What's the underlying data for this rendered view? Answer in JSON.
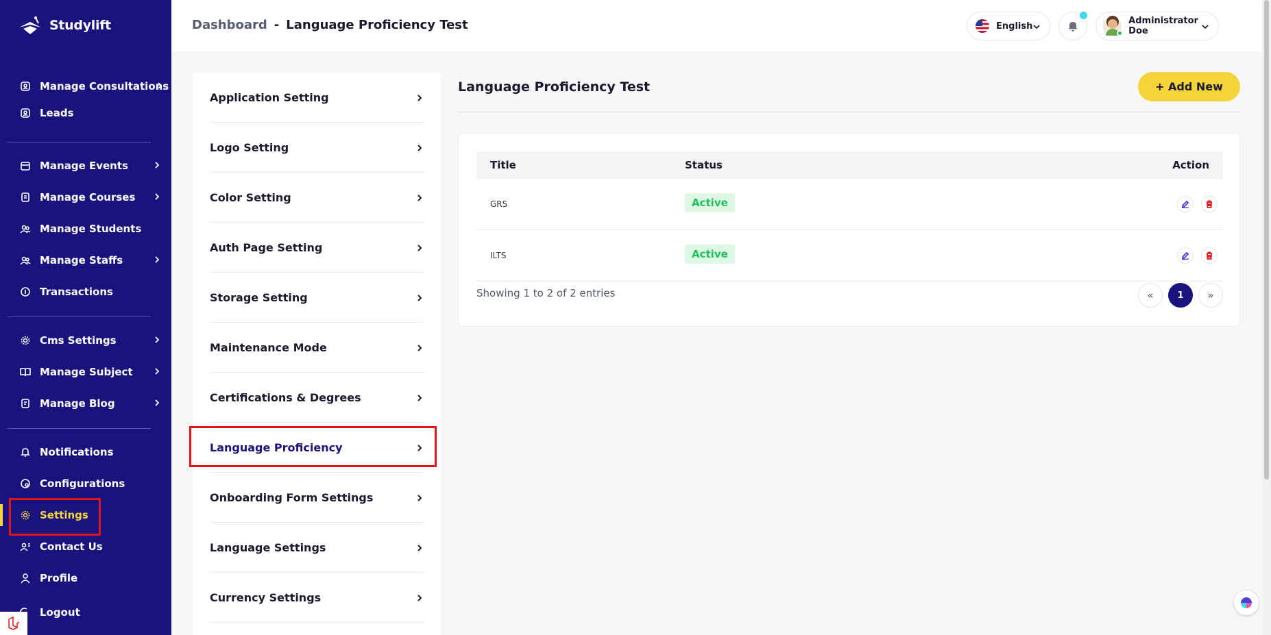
{
  "brand": {
    "name": "Studylift"
  },
  "sidebar": {
    "items": [
      {
        "label": "Manage Consultations",
        "icon": "user-card-icon",
        "chevron": true
      },
      {
        "label": "Leads",
        "icon": "user-card-icon",
        "chevron": false
      },
      {
        "label": "Manage Events",
        "icon": "calendar-icon",
        "chevron": true
      },
      {
        "label": "Manage Courses",
        "icon": "book-icon",
        "chevron": true
      },
      {
        "label": "Manage Students",
        "icon": "users-icon",
        "chevron": false
      },
      {
        "label": "Manage Staffs",
        "icon": "users-icon",
        "chevron": true
      },
      {
        "label": "Transactions",
        "icon": "coin-icon",
        "chevron": false
      },
      {
        "label": "Cms Settings",
        "icon": "gear-icon",
        "chevron": true
      },
      {
        "label": "Manage Subject",
        "icon": "open-book-icon",
        "chevron": true
      },
      {
        "label": "Manage Blog",
        "icon": "document-icon",
        "chevron": true
      },
      {
        "label": "Notifications",
        "icon": "bell-icon",
        "chevron": false
      },
      {
        "label": "Configurations",
        "icon": "config-icon",
        "chevron": false
      },
      {
        "label": "Settings",
        "icon": "gear-icon",
        "chevron": false,
        "active": true
      },
      {
        "label": "Contact Us",
        "icon": "contact-icon",
        "chevron": false
      },
      {
        "label": "Profile",
        "icon": "user-icon",
        "chevron": false
      },
      {
        "label": "Logout",
        "icon": "logout-icon",
        "chevron": false
      }
    ]
  },
  "header": {
    "breadcrumb_root": "Dashboard",
    "breadcrumb_sep": "-",
    "breadcrumb_current": "Language Proficiency Test",
    "language": "English",
    "user_name": "Administrator Doe"
  },
  "settings_menu": {
    "items": [
      "Application Setting",
      "Logo Setting",
      "Color Setting",
      "Auth Page Setting",
      "Storage Setting",
      "Maintenance Mode",
      "Certifications & Degrees",
      "Language Proficiency",
      "Onboarding Form Settings",
      "Language Settings",
      "Currency Settings"
    ],
    "active": "Language Proficiency"
  },
  "main": {
    "title": "Language Proficiency Test",
    "add_button": "+ Add New",
    "table": {
      "headers": {
        "title": "Title",
        "status": "Status",
        "action": "Action"
      },
      "rows": [
        {
          "title": "GRS",
          "status": "Active"
        },
        {
          "title": "ILTS",
          "status": "Active"
        }
      ]
    },
    "showing": "Showing 1 to 2 of 2 entries",
    "pagination": {
      "prev": "«",
      "current": "1",
      "next": "»"
    }
  },
  "colors": {
    "sidebar_bg": "#1a137e",
    "accent_yellow": "#f5d33a",
    "status_active": "#1cc15a",
    "highlight_red": "#e0141b"
  }
}
